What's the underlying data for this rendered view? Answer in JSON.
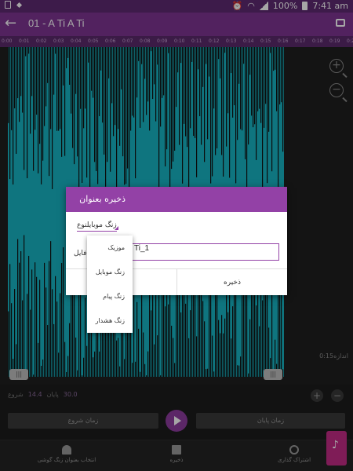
{
  "status_bar": {
    "battery": "100%",
    "time": "7:41 am"
  },
  "toolbar": {
    "title": "01 - A Ti A Ti"
  },
  "ruler": {
    "ticks": [
      "0:00",
      "0:01",
      "0:02",
      "0:03",
      "0:04",
      "0:05",
      "0:06",
      "0:07",
      "0:08",
      "0:09",
      "0:10",
      "0:11",
      "0:12",
      "0:13",
      "0:14",
      "0:15",
      "0:16",
      "0:17",
      "0:18",
      "0:19",
      "0:20"
    ]
  },
  "waveform": {
    "time_label": "0:15اندازه",
    "handle_glyph": "|||"
  },
  "controls": {
    "start_label": "شروع",
    "start_value": "14.4",
    "end_label": "پایان",
    "end_value": "30.0",
    "start_button": "زمان شروع",
    "end_button": "زمان پایان",
    "plus": "+",
    "minus": "−"
  },
  "bottom_nav": {
    "ringtone": "انتخاب بعنوان زنگ گوشی",
    "save": "ذخیره",
    "share": "اشتراک گذاری"
  },
  "dialog": {
    "title": "ذخیره بعنوان",
    "type_label": "زنگ موبایل",
    "type_suffix": "نوع",
    "file_label": "فایل",
    "filename": "Ti_1",
    "save_button": "ذخیره"
  },
  "dropdown": {
    "options": [
      "موزیک",
      "زنگ موبایل",
      "زنگ پیام",
      "زنگ هشدار"
    ]
  },
  "colors": {
    "toolbar": "#7e3593",
    "accent": "#9341a6",
    "wave": "#17b4c4"
  }
}
